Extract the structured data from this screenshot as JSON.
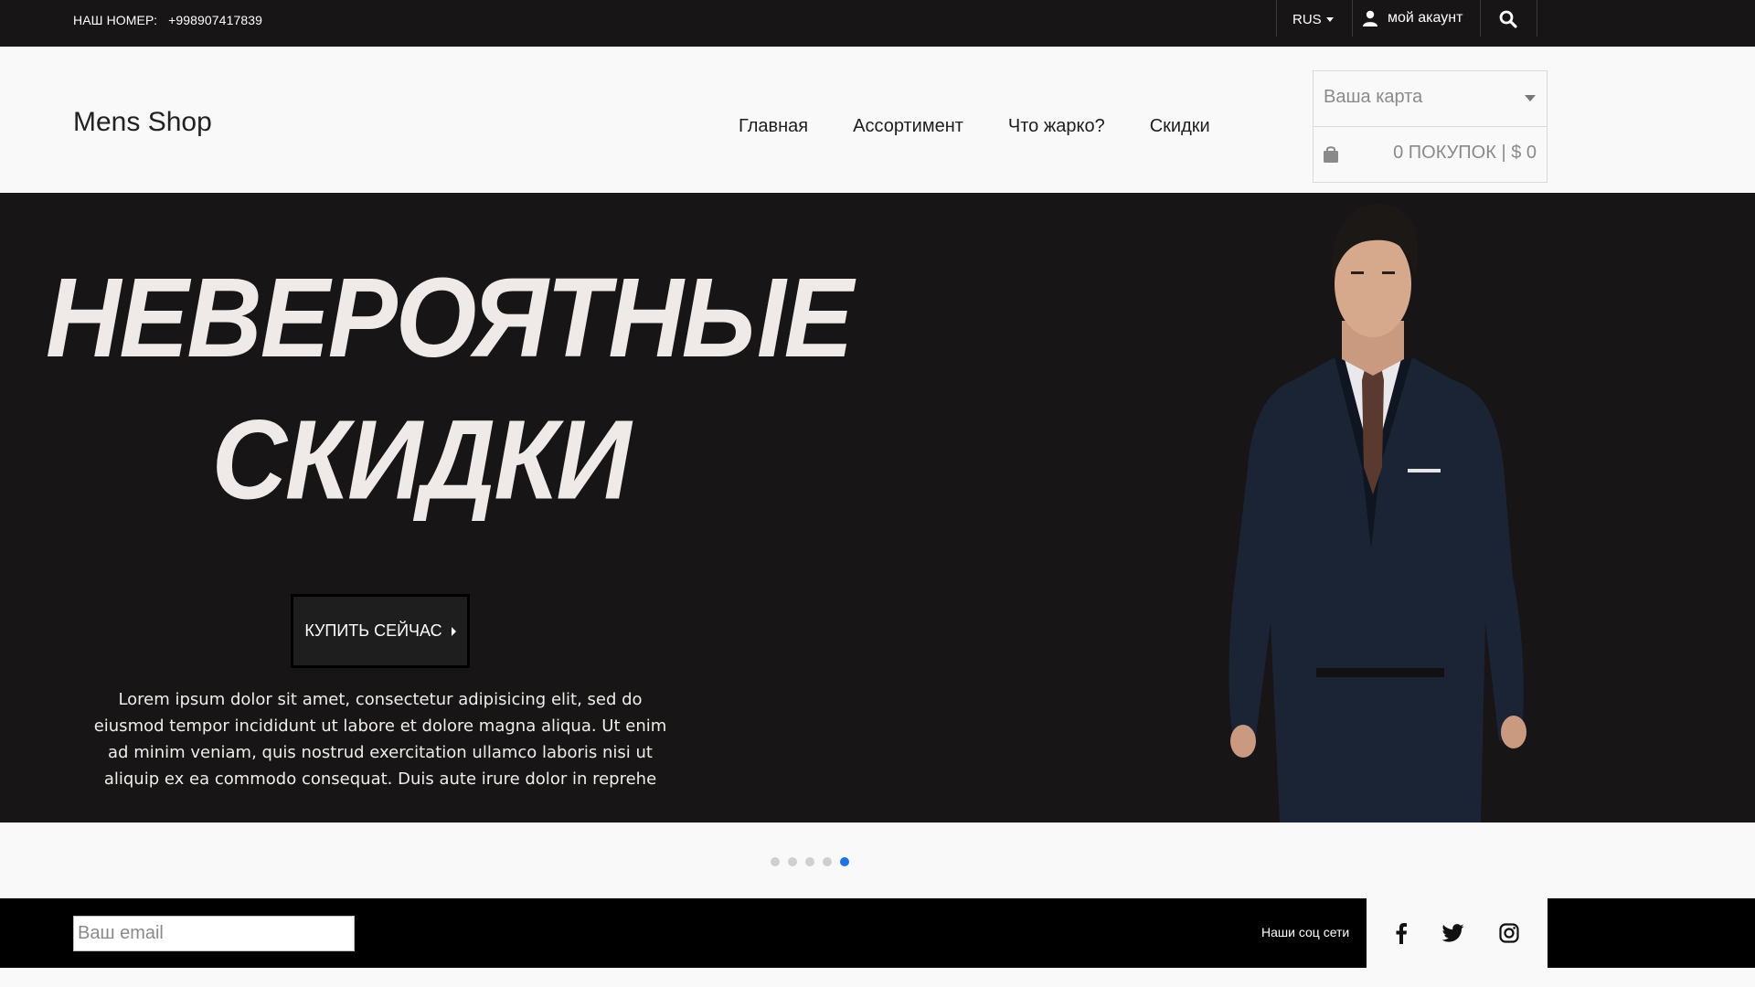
{
  "topbar": {
    "phone_label": "НАШ НОМЕР:",
    "phone_number": "+998907417839",
    "language": "RUS",
    "account_label": "мой акаунт"
  },
  "header": {
    "logo": "Mens Shop",
    "nav": [
      {
        "label": "Главная"
      },
      {
        "label": "Ассортимент"
      },
      {
        "label": "Что жарко?"
      },
      {
        "label": "Скидки"
      }
    ],
    "cart": {
      "select_label": "Ваша карта",
      "summary": "0 ПОКУПОК | $ 0"
    }
  },
  "hero": {
    "title_line1": "НЕВЕРОЯТНЫЕ",
    "title_line2": "СКИДКИ",
    "button_label": "КУПИТЬ СЕЙЧАС",
    "text": "Lorem ipsum dolor sit amet, consectetur adipisicing elit, sed do eiusmod tempor incididunt ut labore et dolore magna aliqua. Ut enim ad minim veniam, quis nostrud exercitation ullamco laboris nisi ut aliquip ex ea commodo consequat. Duis aute irure dolor in reprehe"
  },
  "carousel": {
    "slide_count": 5,
    "active_index": 4,
    "active_color": "#1a73e8",
    "inactive_color": "#cfcfcf"
  },
  "footer": {
    "email_placeholder": "Ваш email",
    "social_label": "Наши соц сети",
    "social_icons": [
      "facebook-icon",
      "twitter-icon",
      "instagram-icon"
    ]
  },
  "colors": {
    "dark_bg": "#171515",
    "page_bg": "#f9f9f9",
    "footer_bg": "#000000",
    "hero_title": "#efe9e7"
  }
}
